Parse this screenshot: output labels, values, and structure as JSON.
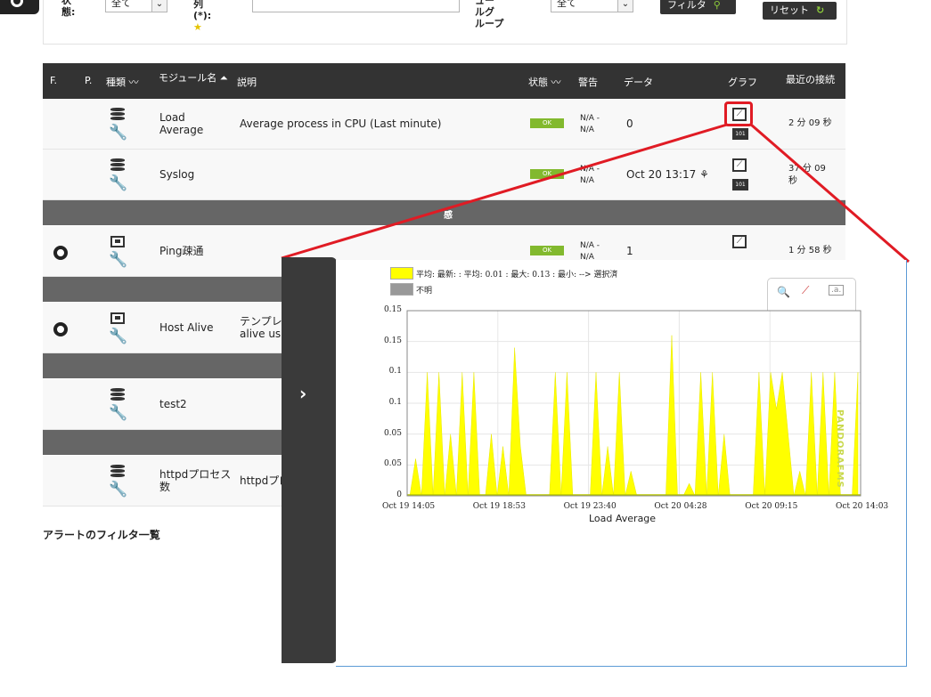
{
  "filters": {
    "status_label_line1": "状",
    "status_label_line2": "態:",
    "status_value": "全て",
    "string_label_line1": "列",
    "string_label_line2": "(*):",
    "group_label_line1": "ュー",
    "group_label_line2": "ルグ",
    "group_label_line3": "ループ",
    "group_value": "全て",
    "filter_button": "フィルタ",
    "reset_button": "リセット"
  },
  "table": {
    "headers": {
      "f": "F.",
      "p": "P.",
      "type": "種類",
      "module_name": "モジュール名",
      "description": "説明",
      "status": "状態",
      "warning": "警告",
      "data": "データ",
      "graph": "グラフ",
      "last_contact": "最近の接続"
    },
    "rows": [
      {
        "name_line1": "Load",
        "name_line2": "Average",
        "description": "Average process in CPU (Last minute)",
        "status": "OK",
        "warn_line1": "N/A -",
        "warn_line2": "N/A",
        "data": "0",
        "badge": "101",
        "last_contact": "2 分 09 秒"
      },
      {
        "name": "Syslog",
        "status": "OK",
        "warn_line1": "N/A -",
        "warn_line2": "N/A",
        "data": "Oct 20 13:17",
        "badge": "101",
        "last_contact_line1": "37 分 09",
        "last_contact_line2": "秒"
      },
      {
        "name": "Ping疎通",
        "status": "OK",
        "warn_line1": "N/A -",
        "warn_line2": "N/A",
        "data": "1",
        "last_contact": "1 分 58 秒"
      },
      {
        "name": "Host Alive",
        "description_line1": "テンプレー",
        "description_line2": "alive usi"
      },
      {
        "name": "test2"
      },
      {
        "name_line1": "httpdプロセス",
        "name_line2": "数",
        "description": "httpdプロ"
      }
    ],
    "group_row_label": "感"
  },
  "alerts_title": "アラートのフィルタ一覧",
  "popup": {
    "legend1": "平均: 最新: : 平均: 0.01 : 最大: 0.13 : 最小: --> 選択済",
    "legend2": "不明",
    "watermark": "PANDORAFMS",
    "colors": {
      "series": "#ffff00",
      "unknown": "#999999",
      "highlight": "#e01b24"
    }
  },
  "chart_data": {
    "type": "area",
    "title": "",
    "xlabel": "Load Average",
    "ylabel": "",
    "y_tick_labels": [
      "0",
      "0.05",
      "0.05",
      "0.1",
      "0.1",
      "0.15",
      "0.15"
    ],
    "x_tick_labels": [
      "Oct 19 14:05",
      "Oct 19 18:53",
      "Oct 19 23:40",
      "Oct 20 04:28",
      "Oct 20 09:15",
      "Oct 20 14:03"
    ],
    "ylim": [
      0,
      0.15
    ],
    "grid": true,
    "series": [
      {
        "values": [
          0,
          0.03,
          0,
          0.1,
          0,
          0.1,
          0,
          0.05,
          0,
          0.1,
          0,
          0.1,
          0,
          0,
          0.05,
          0,
          0.04,
          0,
          0.12,
          0.04,
          0,
          0,
          0,
          0,
          0,
          0.1,
          0,
          0.1,
          0,
          0,
          0,
          0,
          0.1,
          0,
          0.04,
          0,
          0.1,
          0,
          0.02,
          0,
          0,
          0,
          0,
          0,
          0,
          0.13,
          0,
          0,
          0.01,
          0,
          0.1,
          0,
          0.1,
          0,
          0.05,
          0,
          0,
          0,
          0,
          0,
          0.1,
          0,
          0.1,
          0.07,
          0.1,
          0.05,
          0,
          0.02,
          0,
          0.1,
          0,
          0.1,
          0,
          0.1,
          0,
          0,
          0,
          0.1
        ]
      }
    ]
  }
}
